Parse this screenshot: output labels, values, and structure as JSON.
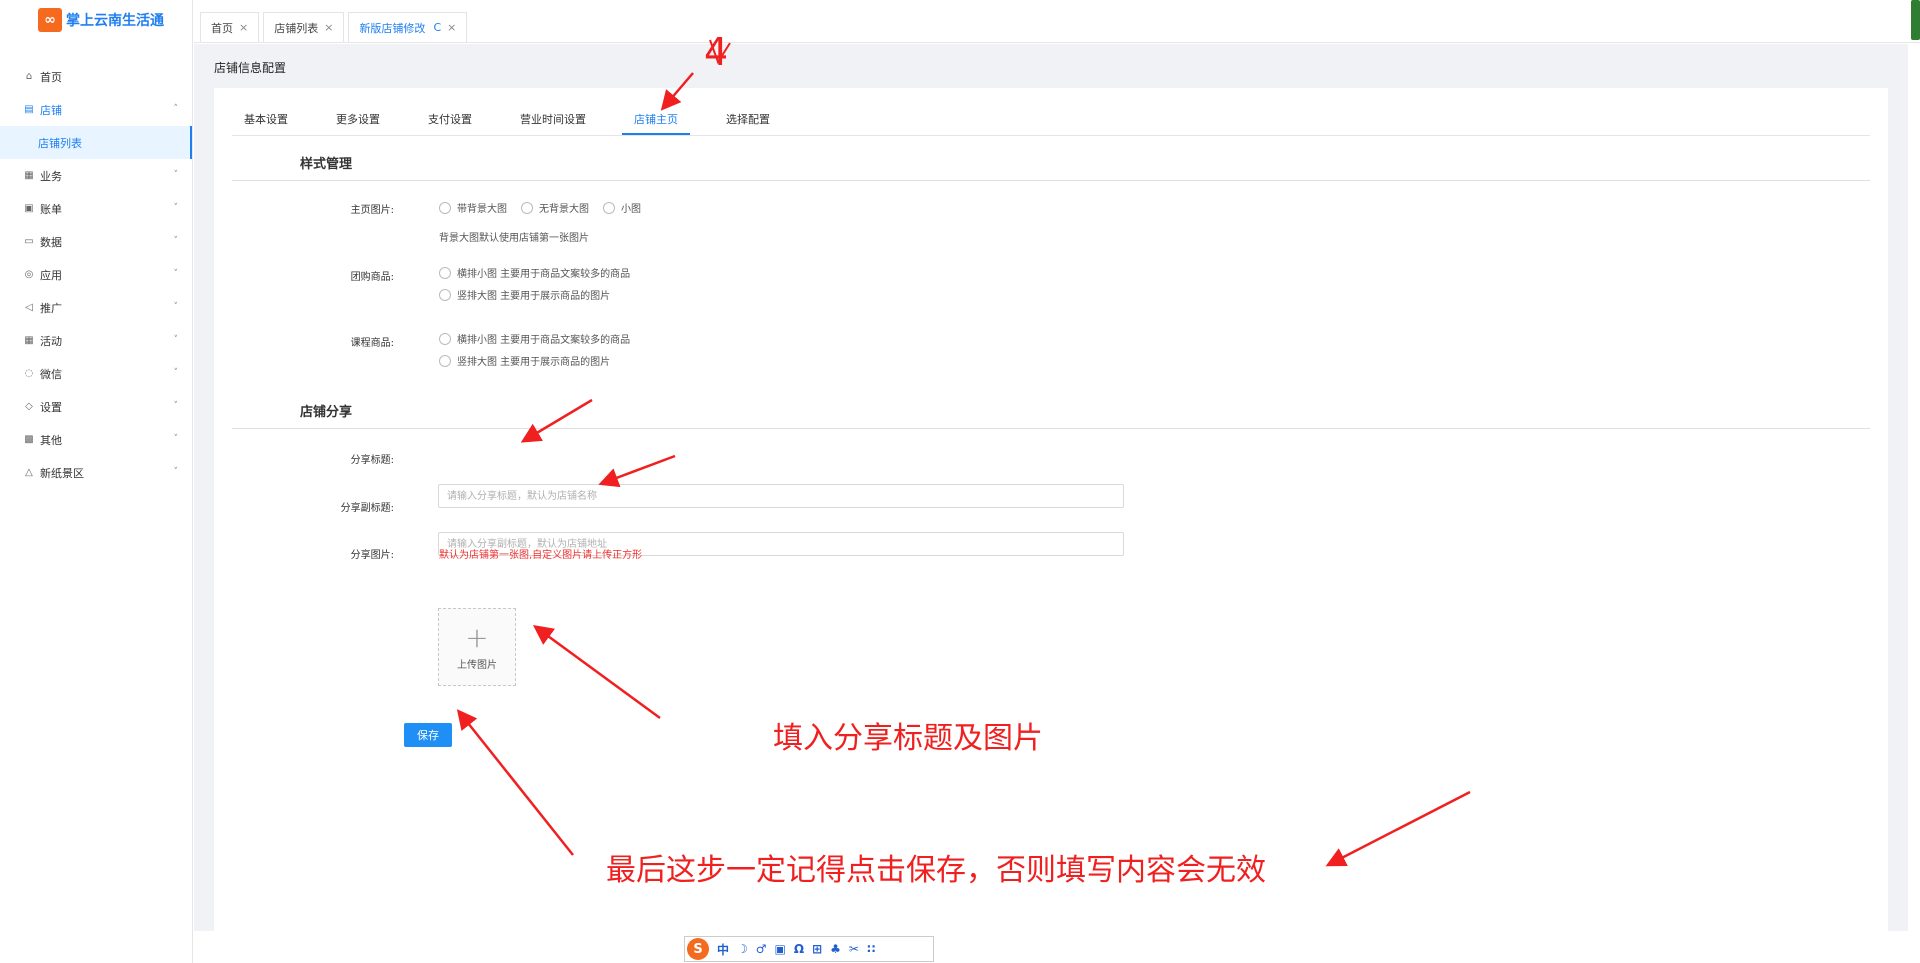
{
  "app": {
    "logo_glyph": "∞",
    "logo_text": "掌上云南生活通"
  },
  "sidebar": {
    "items": [
      {
        "label": "首页",
        "icon": "home-icon",
        "glyph": "⌂"
      },
      {
        "label": "店铺",
        "icon": "shop-icon",
        "glyph": "▤",
        "chev": "˄"
      },
      {
        "label": "业务",
        "icon": "business-icon",
        "glyph": "▦",
        "chev": "˅"
      },
      {
        "label": "账单",
        "icon": "bill-icon",
        "glyph": "▣",
        "chev": "˅"
      },
      {
        "label": "数据",
        "icon": "data-icon",
        "glyph": "▭",
        "chev": "˅"
      },
      {
        "label": "应用",
        "icon": "app-icon",
        "glyph": "◎",
        "chev": "˅"
      },
      {
        "label": "推广",
        "icon": "promote-icon",
        "glyph": "◁",
        "chev": "˅"
      },
      {
        "label": "活动",
        "icon": "activity-icon",
        "glyph": "▦",
        "chev": "˅"
      },
      {
        "label": "微信",
        "icon": "wechat-icon",
        "glyph": "◌",
        "chev": "˅"
      },
      {
        "label": "设置",
        "icon": "settings-icon",
        "glyph": "◇",
        "chev": "˅"
      },
      {
        "label": "其他",
        "icon": "other-icon",
        "glyph": "▩",
        "chev": "˅"
      },
      {
        "label": "新纸景区",
        "icon": "scenic-icon",
        "glyph": "△",
        "chev": "˅"
      }
    ],
    "sub_active": "店铺列表"
  },
  "top_tabs": [
    {
      "label": "首页",
      "close": "×"
    },
    {
      "label": "店铺列表",
      "close": "×"
    },
    {
      "label": "新版店铺修改",
      "refresh": "C",
      "close": "×"
    }
  ],
  "page": {
    "title": "店铺信息配置"
  },
  "sub_tabs": [
    "基本设置",
    "更多设置",
    "支付设置",
    "营业时间设置",
    "店铺主页",
    "选择配置"
  ],
  "style_section": {
    "title": "样式管理",
    "main_image": {
      "label": "主页图片:",
      "options": [
        "带背景大图",
        "无背景大图",
        "小图"
      ],
      "hint": "背景大图默认使用店铺第一张图片"
    },
    "group_goods": {
      "label": "团购商品:",
      "options": [
        "横排小图 主要用于商品文案较多的商品",
        "竖排大图 主要用于展示商品的图片"
      ]
    },
    "course_goods": {
      "label": "课程商品:",
      "options": [
        "横排小图 主要用于商品文案较多的商品",
        "竖排大图 主要用于展示商品的图片"
      ]
    }
  },
  "share_section": {
    "title": "店铺分享",
    "share_title": {
      "label": "分享标题:",
      "placeholder": "请输入分享标题，默认为店铺名称",
      "value": ""
    },
    "share_subtitle": {
      "label": "分享副标题:",
      "placeholder": "请输入分享副标题，默认为店铺地址",
      "value": ""
    },
    "share_image": {
      "label": "分享图片:",
      "hint": "默认为店铺第一张图,自定义图片请上传正方形",
      "upload_label": "上传图片",
      "plus": "+"
    }
  },
  "save_label": "保存",
  "annotations": {
    "number": "4",
    "fill_hint": "填入分享标题及图片",
    "save_hint": "最后这步一定记得点击保存，否则填写内容会无效",
    "color": "#f02020"
  },
  "ime": {
    "logo": "S",
    "items": [
      "中",
      "☽",
      "♂",
      "▣",
      "Ω",
      "⊞",
      "♣",
      "✂",
      "∷"
    ]
  },
  "colors": {
    "accent": "#1f7ff0",
    "danger": "#f03030"
  }
}
